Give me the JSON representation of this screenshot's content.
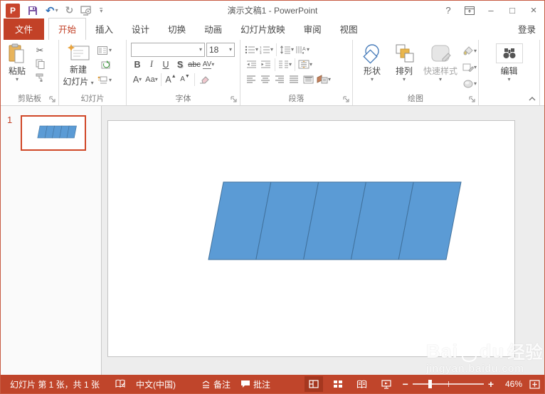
{
  "window": {
    "title": "演示文稿1 - PowerPoint",
    "help": "?",
    "minimize": "–",
    "maximize": "□",
    "close": "×"
  },
  "glyphs": {
    "undo": "↶",
    "redo": "↻",
    "dropdown": "▾",
    "cut": "✂",
    "logo_letter": "P"
  },
  "tabs": {
    "file": "文件",
    "items": [
      "开始",
      "插入",
      "设计",
      "切换",
      "动画",
      "幻灯片放映",
      "审阅",
      "视图"
    ],
    "active": "开始",
    "signin": "登录"
  },
  "ribbon": {
    "clipboard": {
      "label": "剪贴板",
      "paste": "粘贴"
    },
    "slides": {
      "label": "幻灯片",
      "new_slide_line1": "新建",
      "new_slide_line2": "幻灯片"
    },
    "font": {
      "label": "字体",
      "font_name": "",
      "font_size": "18",
      "bold": "B",
      "italic": "I",
      "underline": "U",
      "shadow": "S",
      "strikethrough": "abc",
      "char_spacing": "AV",
      "font_color": "A",
      "change_case": "Aa",
      "grow": "A",
      "shrink": "A"
    },
    "paragraph": {
      "label": "段落"
    },
    "drawing": {
      "label": "绘图",
      "shapes": "形状",
      "arrange": "排列",
      "quick_styles": "快速样式"
    },
    "editing": {
      "label": "编辑"
    }
  },
  "thumbnails": {
    "slide_number": "1"
  },
  "slide": {
    "shape_type": "parallelogram-row",
    "shape_count": 5,
    "shape_fill": "#5B9BD5",
    "shape_stroke": "#41719C"
  },
  "watermark": {
    "brand_left": "Bai",
    "brand_right": "du",
    "brand_cn": "经验",
    "url": "jingyan.baidu.com"
  },
  "status": {
    "slide_info": "幻灯片 第 1 张，共 1 张",
    "language": "中文(中国)",
    "notes": "备注",
    "comments": "批注",
    "zoom_minus": "−",
    "zoom_plus": "+",
    "zoom_level": "46%"
  },
  "colors": {
    "accent": "#C24127",
    "status_bar": "#C0452B",
    "shape_fill": "#5B9BD5",
    "shape_stroke": "#41719C"
  }
}
